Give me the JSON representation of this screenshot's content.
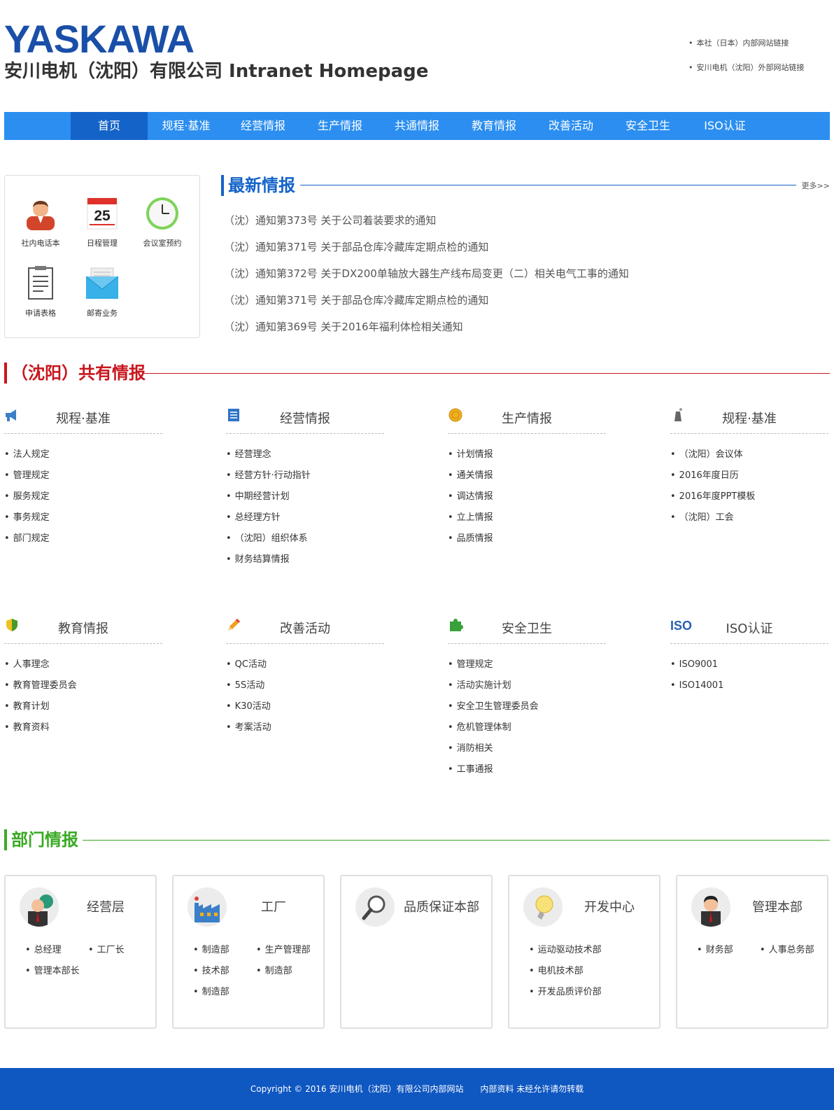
{
  "header": {
    "logo": "YASKAWA",
    "site_title": "安川电机（沈阳）有限公司 Intranet Homepage",
    "ext_links": [
      "本社（日本）内部网站链接",
      "安川电机（沈阳）外部网站链接"
    ]
  },
  "nav": {
    "items": [
      "首页",
      "规程·基准",
      "经营情报",
      "生产情报",
      "共通情报",
      "教育情报",
      "改善活动",
      "安全卫生",
      "ISO认证"
    ],
    "active_index": 0
  },
  "quick": {
    "items": [
      {
        "label": "社内电话本",
        "icon": "person-icon"
      },
      {
        "label": "日程管理",
        "icon": "calendar-icon",
        "day": "25"
      },
      {
        "label": "会议室预约",
        "icon": "clock-icon"
      },
      {
        "label": "申请表格",
        "icon": "form-icon"
      },
      {
        "label": "邮寄业务",
        "icon": "mail-icon"
      }
    ]
  },
  "news": {
    "title": "最新情报",
    "more": "更多>>",
    "items": [
      "（沈）通知第373号 关于公司着装要求的通知",
      "（沈）通知第371号 关于部品仓库冷藏库定期点检的通知",
      "（沈）通知第372号 关于DX200单轴放大器生产线布局变更（二）相关电气工事的通知",
      "（沈）通知第371号 关于部品仓库冷藏库定期点检的通知",
      "（沈）通知第369号 关于2016年福利体检相关通知"
    ]
  },
  "shared": {
    "title": "（沈阳）共有情报",
    "color": "#c8161d",
    "categories": [
      {
        "title": "规程·基准",
        "icon": "megaphone-icon",
        "items": [
          "法人规定",
          "管理规定",
          "服务规定",
          "事务规定",
          "部门规定"
        ]
      },
      {
        "title": "经营情报",
        "icon": "document-icon",
        "items": [
          "经营理念",
          "经营方针·行动指针",
          "中期经营计划",
          "总经理方针",
          "（沈阳）组织体系",
          "财务结算情报"
        ]
      },
      {
        "title": "生产情报",
        "icon": "coin-icon",
        "items": [
          "计划情报",
          "通关情报",
          "调达情报",
          "立上情报",
          "品质情报"
        ]
      },
      {
        "title": "规程·基准",
        "icon": "factory-chimney-icon",
        "items": [
          "（沈阳）会议体",
          "2016年度日历",
          "2016年度PPT模板",
          "（沈阳）工会"
        ]
      },
      {
        "title": "教育情报",
        "icon": "shield-icon",
        "items": [
          "人事理念",
          "教育管理委员会",
          "教育计划",
          "教育资料"
        ]
      },
      {
        "title": "改善活动",
        "icon": "pencil-icon",
        "items": [
          "QC活动",
          "5S活动",
          "K30活动",
          "考案活动"
        ]
      },
      {
        "title": "安全卫生",
        "icon": "puzzle-icon",
        "items": [
          "管理规定",
          "活动实施计划",
          "安全卫生管理委员会",
          "危机管理体制",
          "消防相关",
          "工事通报"
        ]
      },
      {
        "title": "ISO认证",
        "icon": "iso-icon",
        "icon_text": "ISO",
        "items": [
          "ISO9001",
          "ISO14001"
        ]
      }
    ]
  },
  "departments": {
    "title": "部门情报",
    "color": "#3aa924",
    "cards": [
      {
        "title": "经营层",
        "icon": "executive-globe-icon",
        "links": [
          "总经理",
          "工厂长",
          "管理本部长"
        ]
      },
      {
        "title": "工厂",
        "icon": "factory-icon",
        "links": [
          "制造部",
          "生产管理部",
          "技术部",
          "制造部",
          "制造部"
        ]
      },
      {
        "title": "品质保证本部",
        "icon": "magnifier-icon",
        "links": []
      },
      {
        "title": "开发中心",
        "icon": "lightbulb-icon",
        "links": [
          "运动驱动技术部",
          "电机技术部",
          "开发品质评价部"
        ],
        "single_column": true
      },
      {
        "title": "管理本部",
        "icon": "businessman-icon",
        "links": [
          "财务部",
          "人事总务部"
        ]
      }
    ]
  },
  "footer": {
    "copyright": "Copyright © 2016 安川电机（沈阳）有限公司内部网站",
    "notice": "内部资料 未经允许请勿转载"
  }
}
